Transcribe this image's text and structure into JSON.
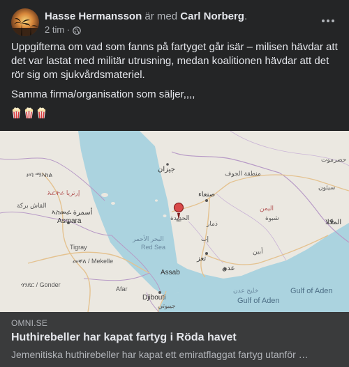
{
  "post": {
    "author": "Hasse Hermansson",
    "with_text": "är med",
    "tagged": "Carl Norberg",
    "tagged_suffix": ".",
    "timestamp": "2 tim ·",
    "audience_icon": "globe-icon",
    "more_icon": "more-dots-icon",
    "paragraph1": "Uppgifterna om vad som fanns på fartyget går isär – milisen hävdar att det var lastat med militär utrusning, medan koalitionen hävdar att det rör sig om sjukvårdsmateriel.",
    "paragraph2": "Samma firma/organisation som säljer,,,,",
    "emoji": [
      "popcorn",
      "popcorn",
      "popcorn"
    ]
  },
  "map": {
    "labels": [
      {
        "text": "حضرموت",
        "cls": "lbl"
      },
      {
        "text": "منطقة الجوف",
        "cls": "lbl"
      },
      {
        "text": "جيزان",
        "cls": "lbl big"
      },
      {
        "text": "سيئون",
        "cls": "lbl"
      },
      {
        "text": "صنعاء",
        "cls": "lbl big"
      },
      {
        "text": "اليمن",
        "cls": "lbl red"
      },
      {
        "text": "شبوة",
        "cls": "lbl"
      },
      {
        "text": "المكلا",
        "cls": "lbl big"
      },
      {
        "text": "ذمار",
        "cls": "lbl"
      },
      {
        "text": "إب",
        "cls": "lbl"
      },
      {
        "text": "تعز",
        "cls": "lbl big"
      },
      {
        "text": "أبين",
        "cls": "lbl"
      },
      {
        "text": "عدن",
        "cls": "lbl big"
      },
      {
        "text": "الحديدة",
        "cls": "lbl"
      },
      {
        "text": "ኤርትራ إرتريا",
        "cls": "lbl red"
      },
      {
        "text": "ዞባ ማእከል",
        "cls": "lbl"
      },
      {
        "text": "القاش بركة",
        "cls": "lbl"
      },
      {
        "text": "ኣስመራ أسمرة",
        "cls": "lbl big"
      },
      {
        "text": "Asmara",
        "cls": "lbl big"
      },
      {
        "text": "Tigray",
        "cls": "lbl"
      },
      {
        "text": "መቐለ / Mekelle",
        "cls": "lbl"
      },
      {
        "text": "ጎንደር / Gonder",
        "cls": "lbl"
      },
      {
        "text": "Afar",
        "cls": "lbl"
      },
      {
        "text": "Assab",
        "cls": "lbl big"
      },
      {
        "text": "Djibouti",
        "cls": "lbl big"
      },
      {
        "text": "جيبوتي",
        "cls": "lbl"
      },
      {
        "text": "البحر الأحمر",
        "cls": "lbl sea"
      },
      {
        "text": "Red Sea",
        "cls": "lbl sea"
      },
      {
        "text": "خليج عدن",
        "cls": "lbl sea"
      },
      {
        "text": "Gulf of Aden",
        "cls": "lbl sea2"
      },
      {
        "text": "Gulf of Aden",
        "cls": "lbl sea2"
      }
    ]
  },
  "link": {
    "domain": "OMNI.SE",
    "title": "Huthirebeller har kapat fartyg i Röda havet",
    "description": "Jemenitiska huthirebeller har kapat ett emiratflaggat fartyg utanför …"
  }
}
